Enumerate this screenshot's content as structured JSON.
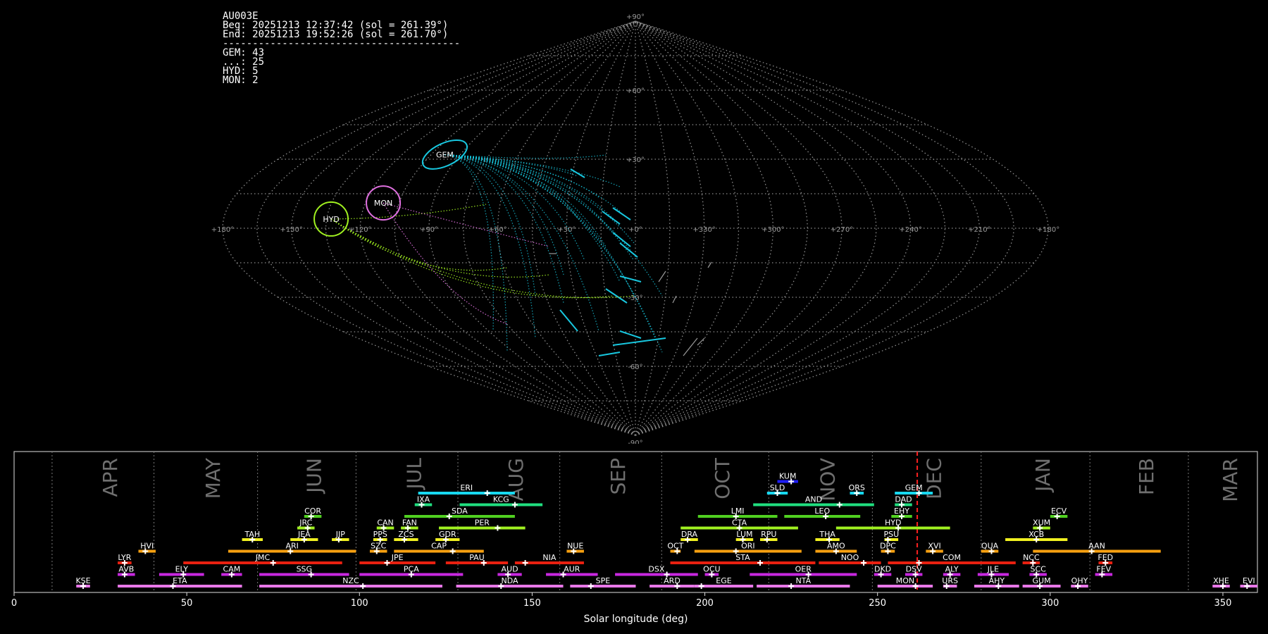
{
  "info": {
    "station": "AU003E",
    "beg": "Beg: 20251213 12:37:42 (sol = 261.39°)",
    "end": "End: 20251213 19:52:26 (sol = 261.70°)",
    "separator": "----------------------------------------",
    "counts": [
      "GEM: 43",
      "...: 25",
      "HYD: 5",
      "MON: 2"
    ]
  },
  "sky_map": {
    "projection": "sinusoidal",
    "lon_labels": [
      "+180°",
      "+150°",
      "+120°",
      "+90°",
      "+60°",
      "+30°",
      "+0°",
      "+330°",
      "+300°",
      "+270°",
      "+240°",
      "+210°",
      "+180°"
    ],
    "lat_labels": [
      "+90°",
      "+60°",
      "+30°",
      "-30°",
      "-60°",
      "-90°"
    ],
    "radiants": [
      {
        "code": "GEM",
        "color": "#18c8e0"
      },
      {
        "code": "MON",
        "color": "#e070e0"
      },
      {
        "code": "HYD",
        "color": "#a0f020"
      }
    ]
  },
  "chart_data": {
    "type": "timeline",
    "xlabel": "Solar longitude (deg)",
    "xlim": [
      0,
      360
    ],
    "xticks": [
      "0",
      "50",
      "100",
      "150",
      "200",
      "250",
      "300",
      "350"
    ],
    "current_sol": 261.5,
    "months": [
      {
        "label": "APR",
        "start": 11
      },
      {
        "label": "MAY",
        "start": 40.5
      },
      {
        "label": "JUN",
        "start": 70.5
      },
      {
        "label": "JUL",
        "start": 99
      },
      {
        "label": "AUG",
        "start": 128.5
      },
      {
        "label": "SEP",
        "start": 158
      },
      {
        "label": "OCT",
        "start": 187.5
      },
      {
        "label": "NOV",
        "start": 218.5
      },
      {
        "label": "DEC",
        "start": 248.5
      },
      {
        "label": "JAN",
        "start": 280
      },
      {
        "label": "FEB",
        "start": 311.5
      },
      {
        "label": "MAR",
        "start": 340
      }
    ],
    "showers": [
      {
        "code": "KUM",
        "start": 221,
        "end": 227,
        "peak": 225,
        "row": 9,
        "color": "#1e1eff"
      },
      {
        "code": "ERI",
        "start": 117,
        "end": 145,
        "peak": 137,
        "row": 8,
        "color": "#18d8f0"
      },
      {
        "code": "SLD",
        "start": 218,
        "end": 224,
        "peak": 221,
        "row": 8,
        "color": "#18d8f0"
      },
      {
        "code": "ORS",
        "start": 242,
        "end": 246,
        "peak": 244,
        "row": 8,
        "color": "#18d8f0"
      },
      {
        "code": "GEM",
        "start": 255,
        "end": 266,
        "peak": 262,
        "row": 8,
        "color": "#18d8f0"
      },
      {
        "code": "IXA",
        "start": 116,
        "end": 121,
        "peak": 118,
        "row": 7,
        "color": "#20e080"
      },
      {
        "code": "KCG",
        "start": 129,
        "end": 153,
        "peak": 145,
        "row": 7,
        "color": "#20e080"
      },
      {
        "code": "AND",
        "start": 214,
        "end": 249,
        "peak": 239,
        "row": 7,
        "color": "#20e080"
      },
      {
        "code": "DAD",
        "start": 255,
        "end": 260,
        "peak": 257,
        "row": 7,
        "color": "#20e080"
      },
      {
        "code": "COR",
        "start": 84,
        "end": 89,
        "peak": 86,
        "row": 6,
        "color": "#50d020"
      },
      {
        "code": "SDA",
        "start": 113,
        "end": 145,
        "peak": 126,
        "row": 6,
        "color": "#50d020"
      },
      {
        "code": "LMI",
        "start": 198,
        "end": 221,
        "peak": 209,
        "row": 6,
        "color": "#50d020"
      },
      {
        "code": "LEO",
        "start": 223,
        "end": 245,
        "peak": 235,
        "row": 6,
        "color": "#50d020"
      },
      {
        "code": "EHY",
        "start": 254,
        "end": 260,
        "peak": 257,
        "row": 6,
        "color": "#50d020"
      },
      {
        "code": "ECV",
        "start": 300,
        "end": 305,
        "peak": 302,
        "row": 6,
        "color": "#50d020"
      },
      {
        "code": "JRC",
        "start": 82,
        "end": 87,
        "peak": 85,
        "row": 5,
        "color": "#a0f020"
      },
      {
        "code": "CAN",
        "start": 105,
        "end": 110,
        "peak": 107,
        "row": 5,
        "color": "#a0f020"
      },
      {
        "code": "FAN",
        "start": 112,
        "end": 117,
        "peak": 114,
        "row": 5,
        "color": "#a0f020"
      },
      {
        "code": "PER",
        "start": 123,
        "end": 148,
        "peak": 140,
        "row": 5,
        "color": "#a0f020"
      },
      {
        "code": "CTA",
        "start": 193,
        "end": 227,
        "peak": 210,
        "row": 5,
        "color": "#a0f020"
      },
      {
        "code": "HYD",
        "start": 238,
        "end": 271,
        "peak": 256,
        "row": 5,
        "color": "#a0f020"
      },
      {
        "code": "XUM",
        "start": 295,
        "end": 300,
        "peak": 297,
        "row": 5,
        "color": "#a0f020"
      },
      {
        "code": "TAH",
        "start": 66,
        "end": 72,
        "peak": 69,
        "row": 4,
        "color": "#f0f020"
      },
      {
        "code": "JEA",
        "start": 80,
        "end": 88,
        "peak": 84,
        "row": 4,
        "color": "#f0f020"
      },
      {
        "code": "JIP",
        "start": 92,
        "end": 97,
        "peak": 94,
        "row": 4,
        "color": "#f0f020"
      },
      {
        "code": "PPS",
        "start": 104,
        "end": 108,
        "peak": 106,
        "row": 4,
        "color": "#f0f020"
      },
      {
        "code": "ZCS",
        "start": 110,
        "end": 117,
        "peak": 113,
        "row": 4,
        "color": "#f0f020"
      },
      {
        "code": "GDR",
        "start": 122,
        "end": 129,
        "peak": 125,
        "row": 4,
        "color": "#f0f020"
      },
      {
        "code": "DRA",
        "start": 193,
        "end": 198,
        "peak": 195,
        "row": 4,
        "color": "#f0f020"
      },
      {
        "code": "LUM",
        "start": 209,
        "end": 214,
        "peak": 211,
        "row": 4,
        "color": "#f0f020"
      },
      {
        "code": "RPU",
        "start": 216,
        "end": 221,
        "peak": 218,
        "row": 4,
        "color": "#f0f020"
      },
      {
        "code": "THA",
        "start": 232,
        "end": 239,
        "peak": 236,
        "row": 4,
        "color": "#f0f020"
      },
      {
        "code": "PSU",
        "start": 252,
        "end": 256,
        "peak": 253,
        "row": 4,
        "color": "#f0f020"
      },
      {
        "code": "XCB",
        "start": 287,
        "end": 305,
        "peak": 296,
        "row": 4,
        "color": "#f0f020"
      },
      {
        "code": "HVI",
        "start": 36,
        "end": 41,
        "peak": 38,
        "row": 3,
        "color": "#f8a010"
      },
      {
        "code": "ARI",
        "start": 62,
        "end": 99,
        "peak": 80,
        "row": 3,
        "color": "#f8a010"
      },
      {
        "code": "SZC",
        "start": 103,
        "end": 108,
        "peak": 105,
        "row": 3,
        "color": "#f8a010"
      },
      {
        "code": "CAP",
        "start": 110,
        "end": 136,
        "peak": 127,
        "row": 3,
        "color": "#f8a010"
      },
      {
        "code": "NUE",
        "start": 160,
        "end": 165,
        "peak": 162,
        "row": 3,
        "color": "#f8a010"
      },
      {
        "code": "OCT",
        "start": 190,
        "end": 193,
        "peak": 192,
        "row": 3,
        "color": "#f8a010"
      },
      {
        "code": "ORI",
        "start": 197,
        "end": 228,
        "peak": 209,
        "row": 3,
        "color": "#f8a010"
      },
      {
        "code": "AMO",
        "start": 232,
        "end": 244,
        "peak": 238,
        "row": 3,
        "color": "#f8a010"
      },
      {
        "code": "DPC",
        "start": 251,
        "end": 255,
        "peak": 253,
        "row": 3,
        "color": "#f8a010"
      },
      {
        "code": "XVI",
        "start": 264,
        "end": 269,
        "peak": 266,
        "row": 3,
        "color": "#f8a010"
      },
      {
        "code": "QUA",
        "start": 280,
        "end": 285,
        "peak": 283,
        "row": 3,
        "color": "#f8a010"
      },
      {
        "code": "AAN",
        "start": 295,
        "end": 332,
        "peak": 312,
        "row": 3,
        "color": "#f8a010"
      },
      {
        "code": "LYR",
        "start": 30,
        "end": 34,
        "peak": 32,
        "row": 2,
        "color": "#e82010"
      },
      {
        "code": "JMC",
        "start": 49,
        "end": 95,
        "peak": 75,
        "row": 2,
        "color": "#e82010"
      },
      {
        "code": "JPE",
        "start": 100,
        "end": 122,
        "peak": 108,
        "row": 2,
        "color": "#e82010"
      },
      {
        "code": "PAU",
        "start": 125,
        "end": 143,
        "peak": 136,
        "row": 2,
        "color": "#e82010"
      },
      {
        "code": "NIA",
        "start": 145,
        "end": 165,
        "peak": 148,
        "row": 2,
        "color": "#e82010"
      },
      {
        "code": "STA",
        "start": 190,
        "end": 232,
        "peak": 216,
        "row": 2,
        "color": "#e82010"
      },
      {
        "code": "NOO",
        "start": 233,
        "end": 251,
        "peak": 246,
        "row": 2,
        "color": "#e82010"
      },
      {
        "code": "COM",
        "start": 253,
        "end": 290,
        "peak": 262,
        "row": 2,
        "color": "#e82010"
      },
      {
        "code": "NCC",
        "start": 292,
        "end": 297,
        "peak": 295,
        "row": 2,
        "color": "#e82010"
      },
      {
        "code": "FED",
        "start": 314,
        "end": 318,
        "peak": 316,
        "row": 2,
        "color": "#e82010"
      },
      {
        "code": "AVB",
        "start": 30,
        "end": 35,
        "peak": 32,
        "row": 1,
        "color": "#c828e0"
      },
      {
        "code": "ELY",
        "start": 42,
        "end": 55,
        "peak": 49,
        "row": 1,
        "color": "#c828e0"
      },
      {
        "code": "CAM",
        "start": 60,
        "end": 66,
        "peak": 63,
        "row": 1,
        "color": "#c828e0"
      },
      {
        "code": "SSG",
        "start": 71,
        "end": 97,
        "peak": 86,
        "row": 1,
        "color": "#c828e0"
      },
      {
        "code": "PCA",
        "start": 100,
        "end": 130,
        "peak": 115,
        "row": 1,
        "color": "#c828e0"
      },
      {
        "code": "AUD",
        "start": 140,
        "end": 147,
        "peak": 143,
        "row": 1,
        "color": "#c828e0"
      },
      {
        "code": "AUR",
        "start": 154,
        "end": 169,
        "peak": 159,
        "row": 1,
        "color": "#c828e0"
      },
      {
        "code": "DSX",
        "start": 174,
        "end": 198,
        "peak": 189,
        "row": 1,
        "color": "#c828e0"
      },
      {
        "code": "OCU",
        "start": 200,
        "end": 204,
        "peak": 202,
        "row": 1,
        "color": "#c828e0"
      },
      {
        "code": "OER",
        "start": 213,
        "end": 244,
        "peak": 230,
        "row": 1,
        "color": "#c828e0"
      },
      {
        "code": "DKD",
        "start": 249,
        "end": 254,
        "peak": 251,
        "row": 1,
        "color": "#c828e0"
      },
      {
        "code": "DSV",
        "start": 258,
        "end": 263,
        "peak": 261,
        "row": 1,
        "color": "#c828e0"
      },
      {
        "code": "ALY",
        "start": 269,
        "end": 274,
        "peak": 271,
        "row": 1,
        "color": "#c828e0"
      },
      {
        "code": "JLE",
        "start": 279,
        "end": 288,
        "peak": 283,
        "row": 1,
        "color": "#c828e0"
      },
      {
        "code": "SCC",
        "start": 294,
        "end": 299,
        "peak": 296,
        "row": 1,
        "color": "#c828e0"
      },
      {
        "code": "FEV",
        "start": 313,
        "end": 318,
        "peak": 315,
        "row": 1,
        "color": "#c828e0"
      },
      {
        "code": "KSE",
        "start": 18,
        "end": 22,
        "peak": 20,
        "row": 0,
        "color": "#e878e8"
      },
      {
        "code": "ETA",
        "start": 30,
        "end": 66,
        "peak": 46,
        "row": 0,
        "color": "#e878e8"
      },
      {
        "code": "NZC",
        "start": 71,
        "end": 124,
        "peak": 101,
        "row": 0,
        "color": "#e878e8"
      },
      {
        "code": "NDA",
        "start": 128,
        "end": 159,
        "peak": 141,
        "row": 0,
        "color": "#e878e8"
      },
      {
        "code": "SPE",
        "start": 161,
        "end": 180,
        "peak": 167,
        "row": 0,
        "color": "#e878e8"
      },
      {
        "code": "ARD",
        "start": 184,
        "end": 197,
        "peak": 192,
        "row": 0,
        "color": "#e878e8"
      },
      {
        "code": "EGE",
        "start": 197,
        "end": 214,
        "peak": 199,
        "row": 0,
        "color": "#e878e8"
      },
      {
        "code": "NTA",
        "start": 215,
        "end": 242,
        "peak": 225,
        "row": 0,
        "color": "#e878e8"
      },
      {
        "code": "MON",
        "start": 250,
        "end": 266,
        "peak": 261,
        "row": 0,
        "color": "#e878e8"
      },
      {
        "code": "URS",
        "start": 269,
        "end": 273,
        "peak": 270,
        "row": 0,
        "color": "#e878e8"
      },
      {
        "code": "AHY",
        "start": 278,
        "end": 291,
        "peak": 285,
        "row": 0,
        "color": "#e878e8"
      },
      {
        "code": "GUM",
        "start": 292,
        "end": 303,
        "peak": 297,
        "row": 0,
        "color": "#e878e8"
      },
      {
        "code": "OHY",
        "start": 306,
        "end": 311,
        "peak": 308,
        "row": 0,
        "color": "#e878e8"
      },
      {
        "code": "XHE",
        "start": 347,
        "end": 352,
        "peak": 350,
        "row": 0,
        "color": "#e878e8"
      },
      {
        "code": "EVI",
        "start": 355,
        "end": 360,
        "peak": 357,
        "row": 0,
        "color": "#e878e8"
      }
    ]
  }
}
